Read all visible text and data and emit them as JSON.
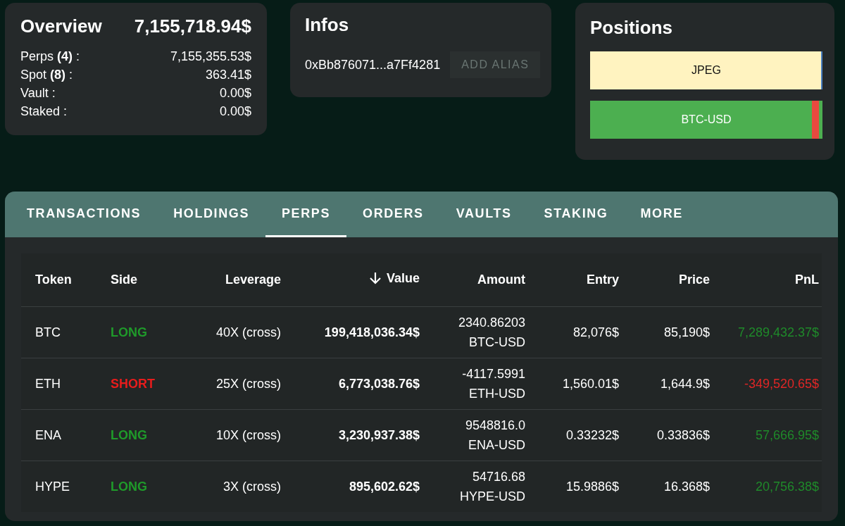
{
  "overview": {
    "title": "Overview",
    "total": "7,155,718.94$",
    "rows": [
      {
        "label": "Perps **(4)** :",
        "value": "7,155,355.53$"
      },
      {
        "label": "Spot **(8)** :",
        "value": "363.41$"
      },
      {
        "label": "Vault :",
        "value": "0.00$"
      },
      {
        "label": "Staked :",
        "value": "0.00$"
      }
    ]
  },
  "infos": {
    "title": "Infos",
    "address": "0xBb876071...a7Ff4281",
    "button": "ADD ALIAS"
  },
  "positions": {
    "title": "Positions",
    "bars": [
      {
        "label": "JPEG",
        "segments": [
          {
            "level": 0.995,
            "color": "#fff3c0"
          },
          {
            "level": 0.005,
            "color": "#4a7fc0"
          }
        ]
      },
      {
        "label": "BTC-USD",
        "segments": [
          {
            "level": 0.955,
            "color": "#4caf50"
          },
          {
            "level": 0.03,
            "color": "#e84a3f"
          },
          {
            "level": 0.015,
            "color": "#4caf50"
          }
        ]
      }
    ]
  },
  "tabs": [
    {
      "label": "TRANSACTIONS",
      "selected": false
    },
    {
      "label": "HOLDINGS",
      "selected": false
    },
    {
      "label": "PERPS",
      "selected": true
    },
    {
      "label": "ORDERS",
      "selected": false
    },
    {
      "label": "VAULTS",
      "selected": false
    },
    {
      "label": "STAKING",
      "selected": false
    },
    {
      "label": "MORE",
      "selected": false
    }
  ],
  "table": {
    "columns": [
      {
        "label": "Token",
        "sorted": false
      },
      {
        "label": "Side",
        "sorted": false
      },
      {
        "label": "Leverage",
        "sorted": false
      },
      {
        "label": "Value",
        "sorted": true
      },
      {
        "label": "Amount",
        "sorted": false
      },
      {
        "label": "Entry",
        "sorted": false
      },
      {
        "label": "Price",
        "sorted": false
      },
      {
        "label": "PnL",
        "sorted": false
      }
    ],
    "rows": [
      {
        "token": "BTC",
        "side": {
          "text": "LONG",
          "kind": "long"
        },
        "leverage": "40X (cross)",
        "value": "199,418,036.34$",
        "amount": "2340.86203",
        "pair": "BTC-USD",
        "entry": "82,076$",
        "price": "85,190$",
        "pnl": {
          "text": "7,289,432.37$",
          "kind": "gain"
        }
      },
      {
        "token": "ETH",
        "side": {
          "text": "SHORT",
          "kind": "short"
        },
        "leverage": "25X (cross)",
        "value": "6,773,038.76$",
        "amount": "-4117.5991",
        "pair": "ETH-USD",
        "entry": "1,560.01$",
        "price": "1,644.9$",
        "pnl": {
          "text": "-349,520.65$",
          "kind": "loss"
        }
      },
      {
        "token": "ENA",
        "side": {
          "text": "LONG",
          "kind": "long"
        },
        "leverage": "10X (cross)",
        "value": "3,230,937.38$",
        "amount": "9548816.0",
        "pair": "ENA-USD",
        "entry": "0.33232$",
        "price": "0.33836$",
        "pnl": {
          "text": "57,666.95$",
          "kind": "gain"
        }
      },
      {
        "token": "HYPE",
        "side": {
          "text": "LONG",
          "kind": "long"
        },
        "leverage": "3X (cross)",
        "value": "895,602.62$",
        "amount": "54716.68",
        "pair": "HYPE-USD",
        "entry": "15.9886$",
        "price": "16.368$",
        "pnl": {
          "text": "20,756.38$",
          "kind": "gain"
        }
      }
    ]
  }
}
